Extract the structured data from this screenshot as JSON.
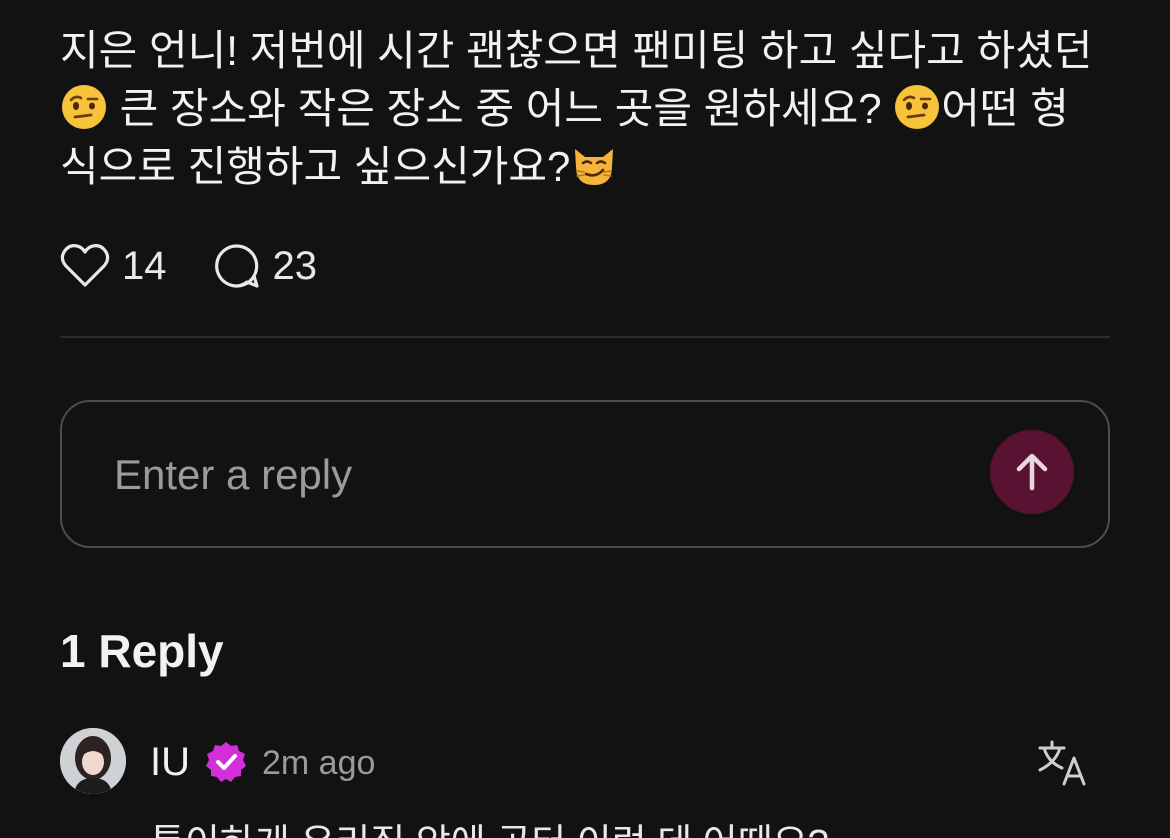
{
  "post": {
    "line1": "지은 언니! 저번에 시간 괜찮으면 팬미팅 하고 싶다고 하셨던",
    "emoji1": "raised-eyebrow-emoji",
    "line2": " 큰 장소와 작은 장소 중 어느 곳을 원하세요? ",
    "emoji2": "raised-eyebrow-emoji",
    "line2b": "어떤 형",
    "line3": "식으로 진행하고 싶으신가요?",
    "emoji3": "smirking-cat-emoji"
  },
  "actions": {
    "likes": "14",
    "comments": "23",
    "like_icon": "heart-icon",
    "comment_icon": "speech-bubble-icon"
  },
  "reply_box": {
    "placeholder": "Enter a reply",
    "send_icon": "arrow-up-icon",
    "send_color": "#5a1232"
  },
  "replies": {
    "heading": "1 Reply",
    "items": [
      {
        "author": "IU",
        "verified_icon": "verified-badge-icon",
        "verified_color": "#d12fd8",
        "time": "2m ago",
        "translate_icon": "translate-icon",
        "text": "특이하게 우리집 앞에 공터 이런 데 어때요?"
      }
    ]
  }
}
